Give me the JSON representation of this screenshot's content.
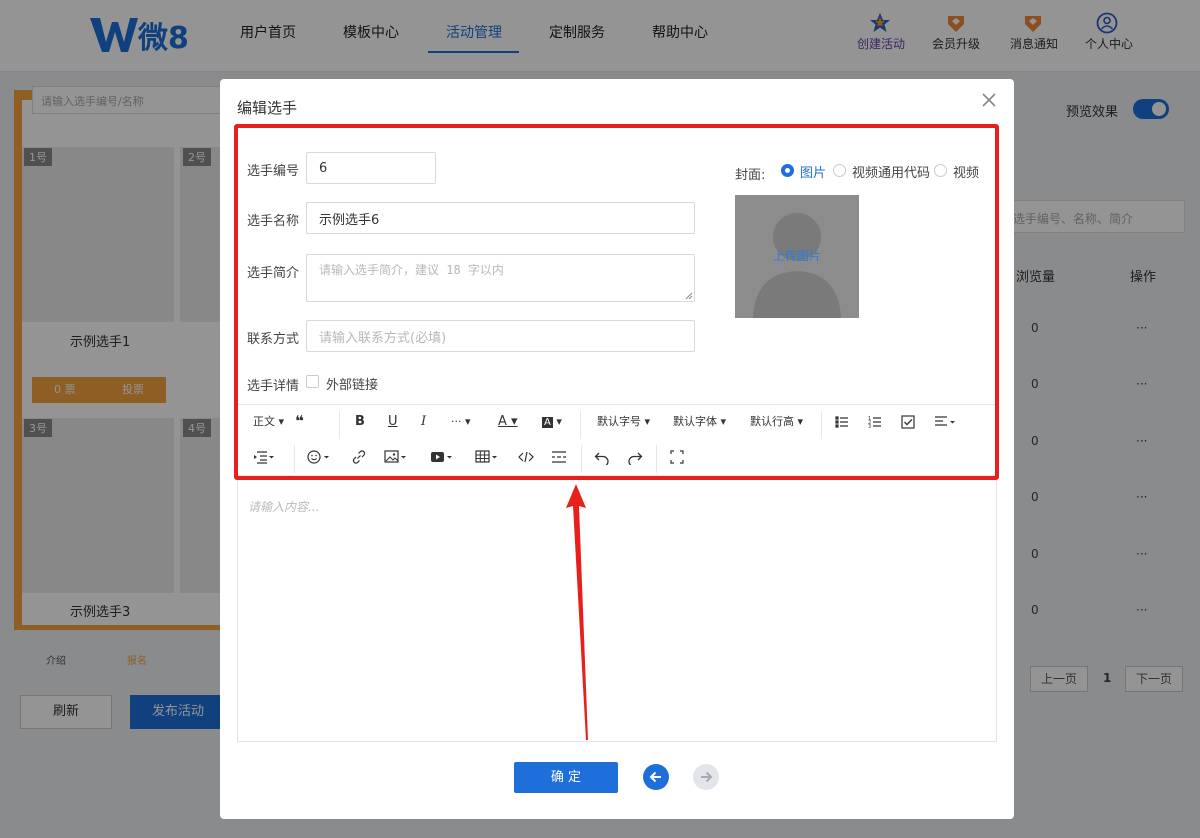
{
  "header": {
    "logo_text": "微8",
    "nav": [
      "用户首页",
      "模板中心",
      "活动管理",
      "定制服务",
      "帮助中心"
    ],
    "active_nav": "活动管理",
    "tools": [
      "创建活动",
      "会员升级",
      "消息通知",
      "个人中心"
    ]
  },
  "background": {
    "left_search_placeholder": "请输入选手编号/名称",
    "cards": [
      {
        "badge": "1号",
        "name": "示例选手1",
        "votes": "0 票",
        "vote_btn": "投票",
        "badge2": "2号"
      },
      {
        "badge": "3号",
        "name": "示例选手3",
        "badge2": "4号"
      }
    ],
    "bottom_nav": [
      "介绍",
      "报名"
    ],
    "refresh": "刷新",
    "publish": "发布活动",
    "preview_label": "预览效果",
    "right_search_placeholder": "选手编号、名称、简介",
    "col_views": "浏览量",
    "col_ops": "操作",
    "rows": [
      "0",
      "0",
      "0",
      "0",
      "0",
      "0"
    ],
    "row_ops": "···",
    "prev_page": "上一页",
    "page": "1",
    "next_page": "下一页"
  },
  "modal": {
    "title": "编辑选手",
    "fields": {
      "number_label": "选手编号",
      "number_value": "6",
      "name_label": "选手名称",
      "name_value": "示例选手6",
      "intro_label": "选手简介",
      "intro_placeholder": "请输入选手简介，建议 18 字以内",
      "contact_label": "联系方式",
      "contact_placeholder": "请输入联系方式(必填)",
      "detail_label": "选手详情",
      "external_link": "外部链接"
    },
    "cover": {
      "label": "封面:",
      "options": [
        "图片",
        "视频通用代码",
        "视频"
      ],
      "selected": "图片",
      "upload_text": "上传图片"
    },
    "toolbar": {
      "row1": [
        "正文",
        "❝",
        "B",
        "U",
        "I",
        "···",
        "A",
        "A",
        "默认字号",
        "默认字体",
        "默认行高"
      ],
      "row2": []
    },
    "editor_placeholder": "请输入内容...",
    "confirm": "确 定"
  },
  "colors": {
    "accent": "#1e6fd9",
    "highlight": "#e8201c",
    "orange": "#f4a340"
  }
}
